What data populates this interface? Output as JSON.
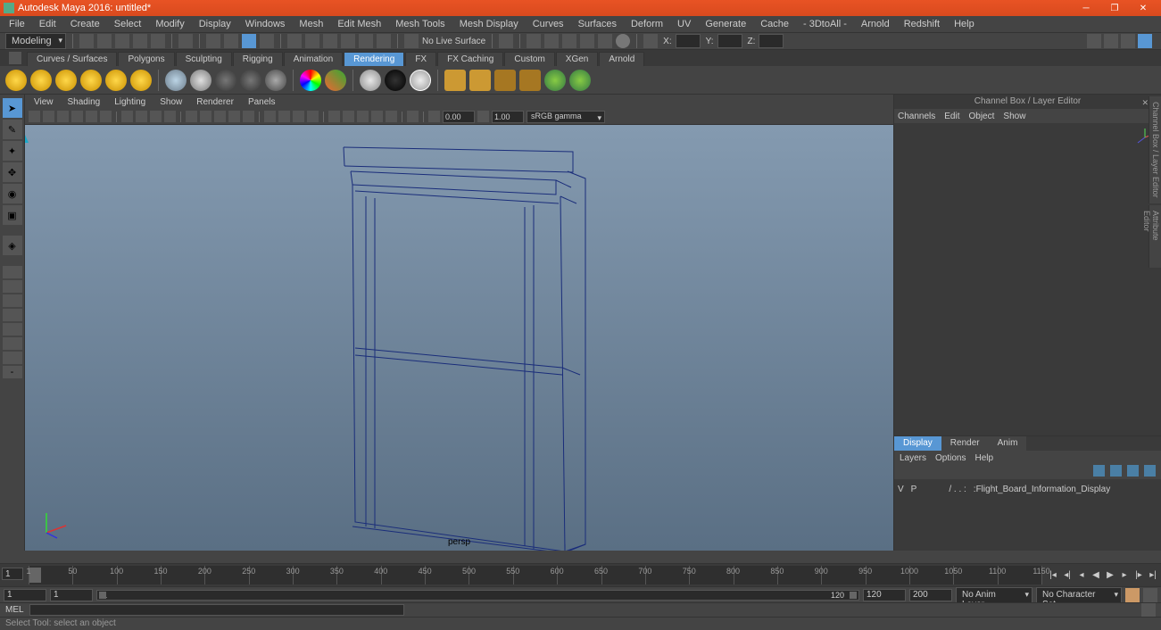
{
  "title": "Autodesk Maya 2016: untitled*",
  "menus": [
    "File",
    "Edit",
    "Create",
    "Select",
    "Modify",
    "Display",
    "Windows",
    "Mesh",
    "Edit Mesh",
    "Mesh Tools",
    "Mesh Display",
    "Curves",
    "Surfaces",
    "Deform",
    "UV",
    "Generate",
    "Cache",
    "- 3DtoAll -",
    "Arnold",
    "Redshift",
    "Help"
  ],
  "workspace_dropdown": "Modeling",
  "snap_label": "No Live Surface",
  "coords": {
    "x_label": "X:",
    "y_label": "Y:",
    "z_label": "Z:",
    "x": "",
    "y": "",
    "z": ""
  },
  "shelf_tabs": [
    "Curves / Surfaces",
    "Polygons",
    "Sculpting",
    "Rigging",
    "Animation",
    "Rendering",
    "FX",
    "FX Caching",
    "Custom",
    "XGen",
    "Arnold"
  ],
  "panel_menus": [
    "View",
    "Shading",
    "Lighting",
    "Show",
    "Renderer",
    "Panels"
  ],
  "exposure_value": "0.00",
  "gamma_value": "1.00",
  "color_mgmt": "sRGB gamma",
  "view_label": "persp",
  "channel_box_title": "Channel Box / Layer Editor",
  "channel_tabs": [
    "Channels",
    "Edit",
    "Object",
    "Show"
  ],
  "layer_tabs": [
    "Display",
    "Render",
    "Anim"
  ],
  "layer_menus": [
    "Layers",
    "Options",
    "Help"
  ],
  "layer_row": {
    "v": "V",
    "p": "P",
    "flags": "/ . . :",
    "name": ":Flight_Board_Information_Display"
  },
  "timeline": {
    "start": 1,
    "end": 120,
    "ticks": [
      1,
      50,
      100,
      150,
      200,
      250,
      300,
      350,
      400,
      450,
      500,
      550,
      600,
      650,
      700,
      750,
      800,
      850,
      900,
      950,
      1000,
      1050,
      1100,
      1150
    ],
    "play_start": "1",
    "play_end": "120",
    "range_start": "1",
    "range_end": "1",
    "disp_end": "120",
    "range_out": "200"
  },
  "anim_layer": "No Anim Layer",
  "char_set": "No Character Set",
  "cmd_label": "MEL",
  "help_text": "Select Tool: select an object",
  "vert_tabs": [
    "Channel Box / Layer Editor",
    "Attribute Editor"
  ]
}
